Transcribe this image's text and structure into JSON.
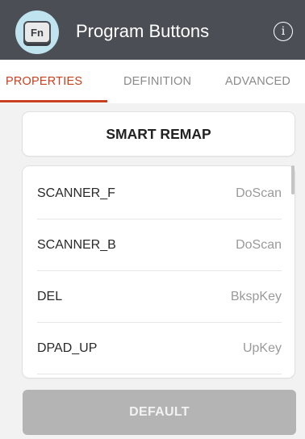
{
  "app_bar": {
    "icon_label": "Fn",
    "title": "Program Buttons",
    "info_icon": "info-icon"
  },
  "tabs": [
    {
      "label": "PROPERTIES",
      "active": true
    },
    {
      "label": "DEFINITION",
      "active": false
    },
    {
      "label": "ADVANCED",
      "active": false
    }
  ],
  "smart_remap": {
    "label": "SMART REMAP"
  },
  "buttons": [
    {
      "key": "SCANNER_F",
      "value": "DoScan"
    },
    {
      "key": "SCANNER_B",
      "value": "DoScan"
    },
    {
      "key": "DEL",
      "value": "BkspKey"
    },
    {
      "key": "DPAD_UP",
      "value": "UpKey"
    }
  ],
  "default_button": {
    "label": "DEFAULT"
  },
  "colors": {
    "app_bar": "#4b4f55",
    "accent": "#c8401f",
    "disabled_button": "#b4b4b4",
    "background": "#f2f2f2"
  }
}
